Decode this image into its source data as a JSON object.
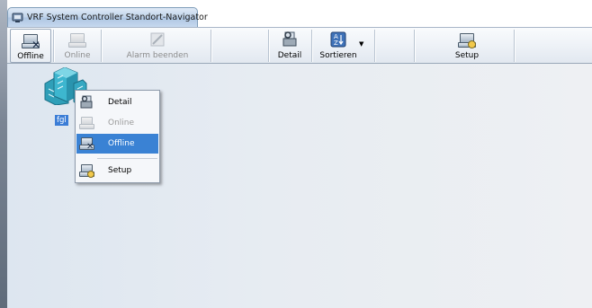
{
  "window": {
    "title": "VRF System Controller Standort-Navigator",
    "icon": "controller-app-icon"
  },
  "toolbar": {
    "offline_label": "Offline",
    "online_label": "Online",
    "alarm_label": "Alarm beenden",
    "detail_label": "Detail",
    "sort_label": "Sortieren",
    "setup_label": "Setup"
  },
  "site": {
    "label": "fgl",
    "icon": "building-site-icon"
  },
  "context_menu": {
    "items": [
      {
        "label": "Detail",
        "icon": "detail-icon",
        "state": "normal"
      },
      {
        "label": "Online",
        "icon": "online-icon",
        "state": "disabled"
      },
      {
        "label": "Offline",
        "icon": "offline-icon",
        "state": "highlighted"
      },
      {
        "label": "Setup",
        "icon": "setup-icon",
        "state": "normal"
      }
    ]
  },
  "colors": {
    "selection": "#3a82d4",
    "titlebar": "#bfd3ea",
    "workspace": "#e3e9f0"
  }
}
